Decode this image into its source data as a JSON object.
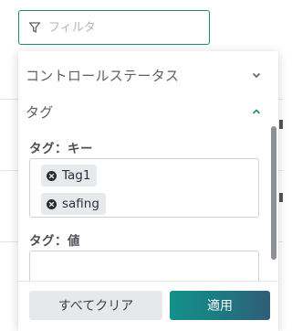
{
  "filter": {
    "placeholder": "フィルタ",
    "icon": "filter-icon"
  },
  "sections": {
    "status": {
      "title": "コントロールステータス",
      "expanded": false
    },
    "tags": {
      "title": "タグ",
      "expanded": true,
      "key_label": "タグ：キー",
      "keys": [
        {
          "label": "Tag1"
        },
        {
          "label": "safing"
        }
      ],
      "value_label": "タグ：値"
    }
  },
  "footer": {
    "clear_label": "すべてクリア",
    "apply_label": "適用"
  },
  "colors": {
    "accent": "#1f8a80",
    "apply_start": "#14908a",
    "apply_end": "#2f5d78"
  }
}
